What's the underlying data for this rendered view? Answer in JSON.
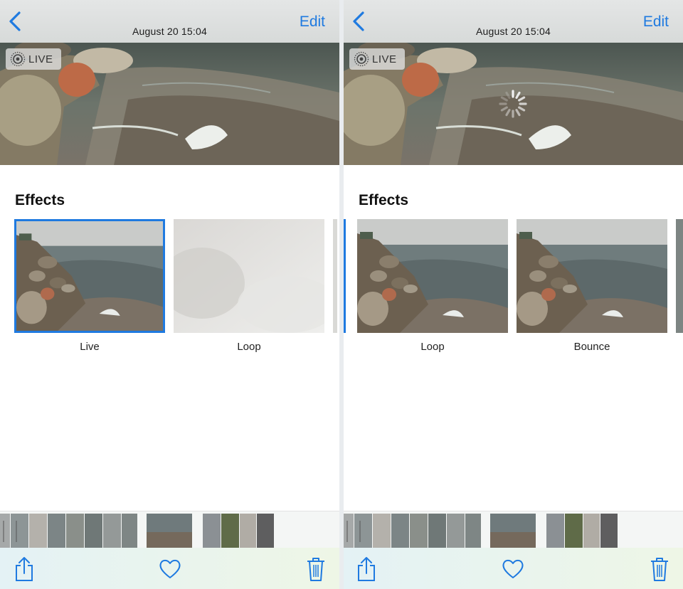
{
  "screens": [
    {
      "header": {
        "date": "August 20  15:04",
        "edit_label": "Edit"
      },
      "live_badge": "LIVE",
      "loading": false,
      "effects": {
        "title": "Effects",
        "items": [
          {
            "label": "Live",
            "selected": true
          },
          {
            "label": "Loop",
            "selected": false
          }
        ]
      }
    },
    {
      "header": {
        "date": "August 20  15:04",
        "edit_label": "Edit"
      },
      "live_badge": "LIVE",
      "loading": true,
      "effects": {
        "title": "Effects",
        "items": [
          {
            "label": "Loop",
            "selected": false
          },
          {
            "label": "Bounce",
            "selected": false
          }
        ]
      }
    }
  ],
  "icons": {
    "back": "chevron-left-icon",
    "live": "live-photo-icon",
    "loading": "activity-spinner-icon",
    "share": "share-icon",
    "favorite": "heart-icon",
    "delete": "trash-icon"
  },
  "colors": {
    "accent": "#1f7ae0",
    "toolbar": "#e8f3f1"
  }
}
